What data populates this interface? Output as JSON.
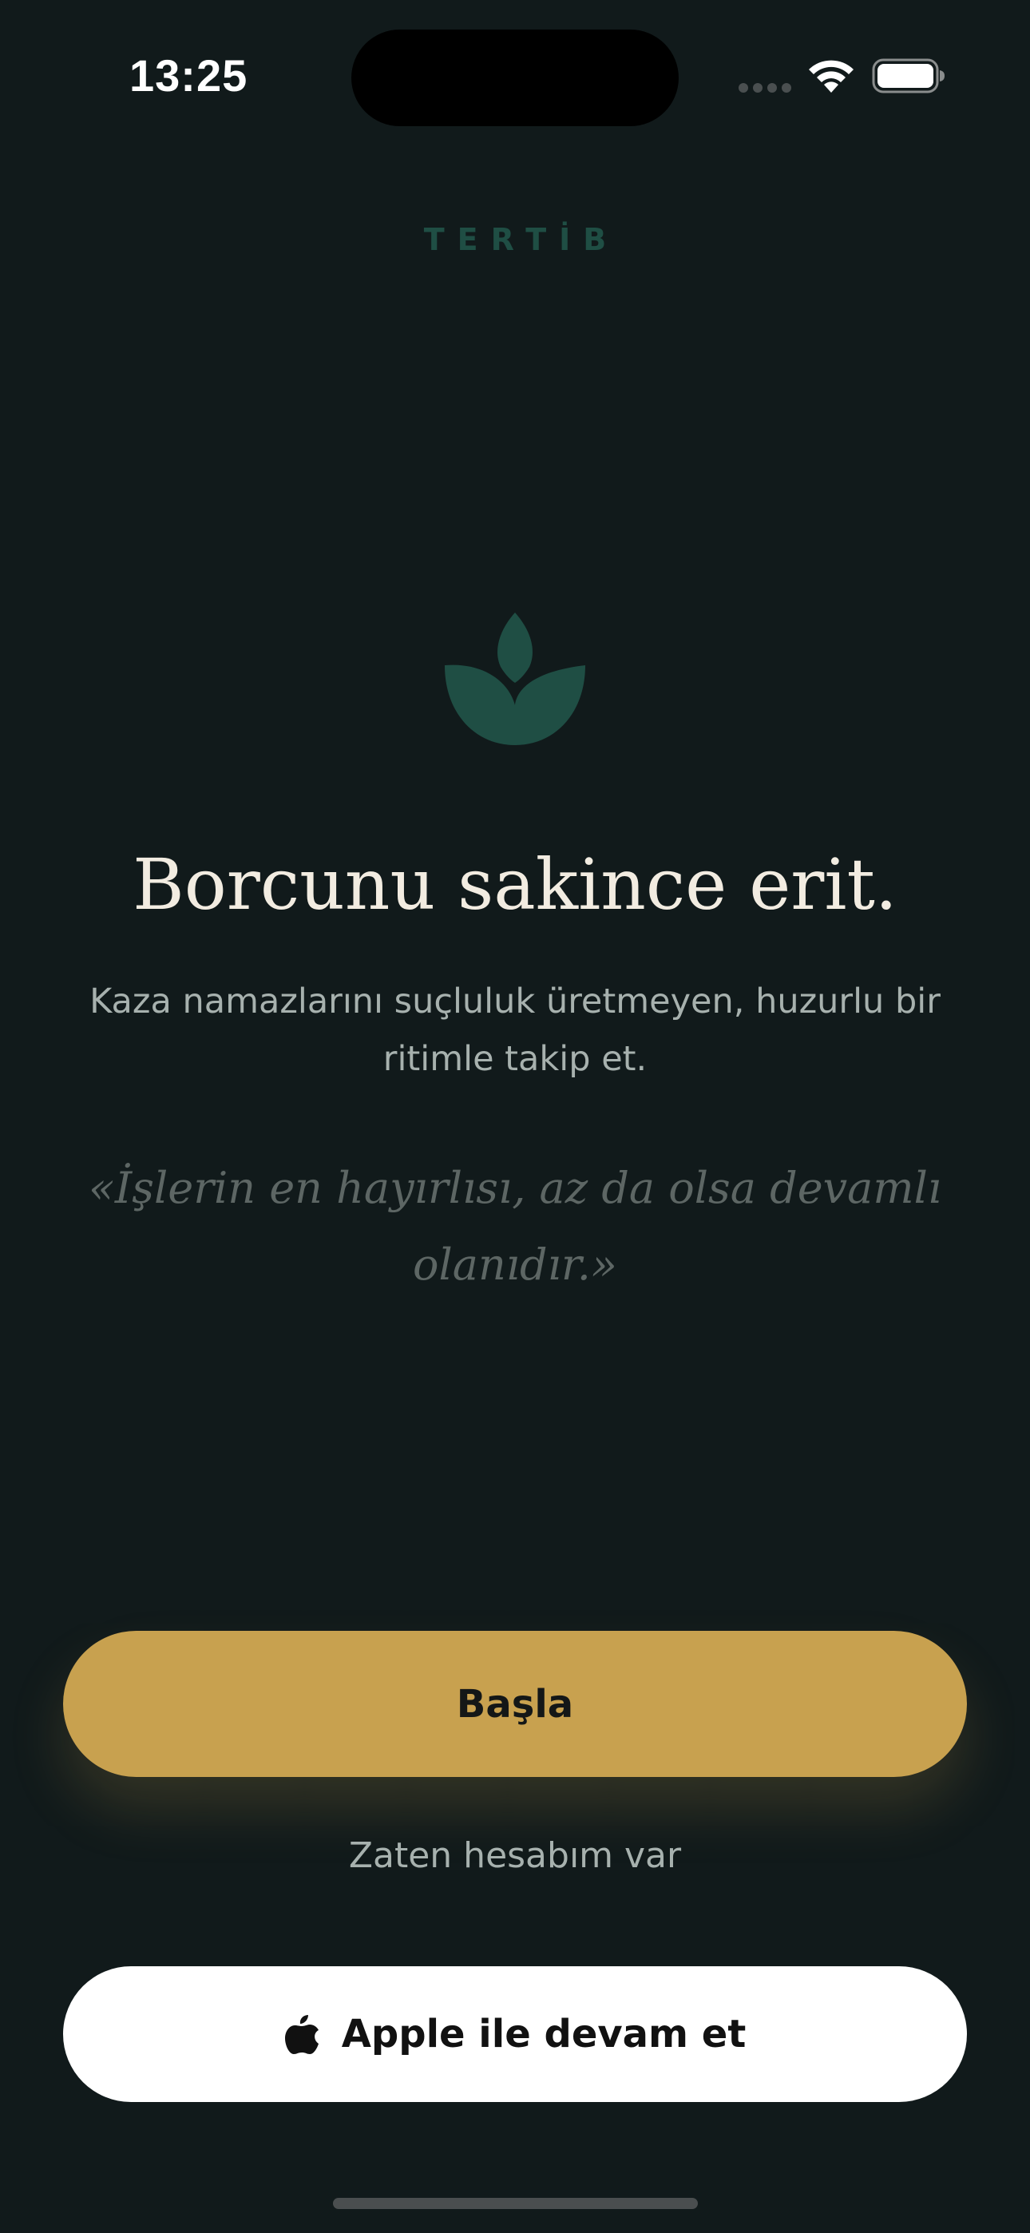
{
  "status_bar": {
    "time": "13:25",
    "signal_icon": "signal-icon",
    "wifi_icon": "wifi-icon",
    "battery_icon": "battery-icon"
  },
  "brand": {
    "name": "TERTİB"
  },
  "hero": {
    "icon": "leaf-icon",
    "title": "Borcunu sakince erit.",
    "subtitle": "Kaza namazlarını suçluluk üretmeyen, huzurlu bir ritimle takip et.",
    "quote": "«İşlerin en hayırlısı, az da olsa devamlı olanıdır.»"
  },
  "actions": {
    "start_label": "Başla",
    "login_label": "Zaten hesabım var",
    "apple_label": "Apple ile devam et",
    "apple_icon": "apple-icon"
  },
  "colors": {
    "background": "#111a1b",
    "accent_gold": "#c8a14f",
    "brand_green": "#1f4e44",
    "title_text": "#f2ece1"
  }
}
